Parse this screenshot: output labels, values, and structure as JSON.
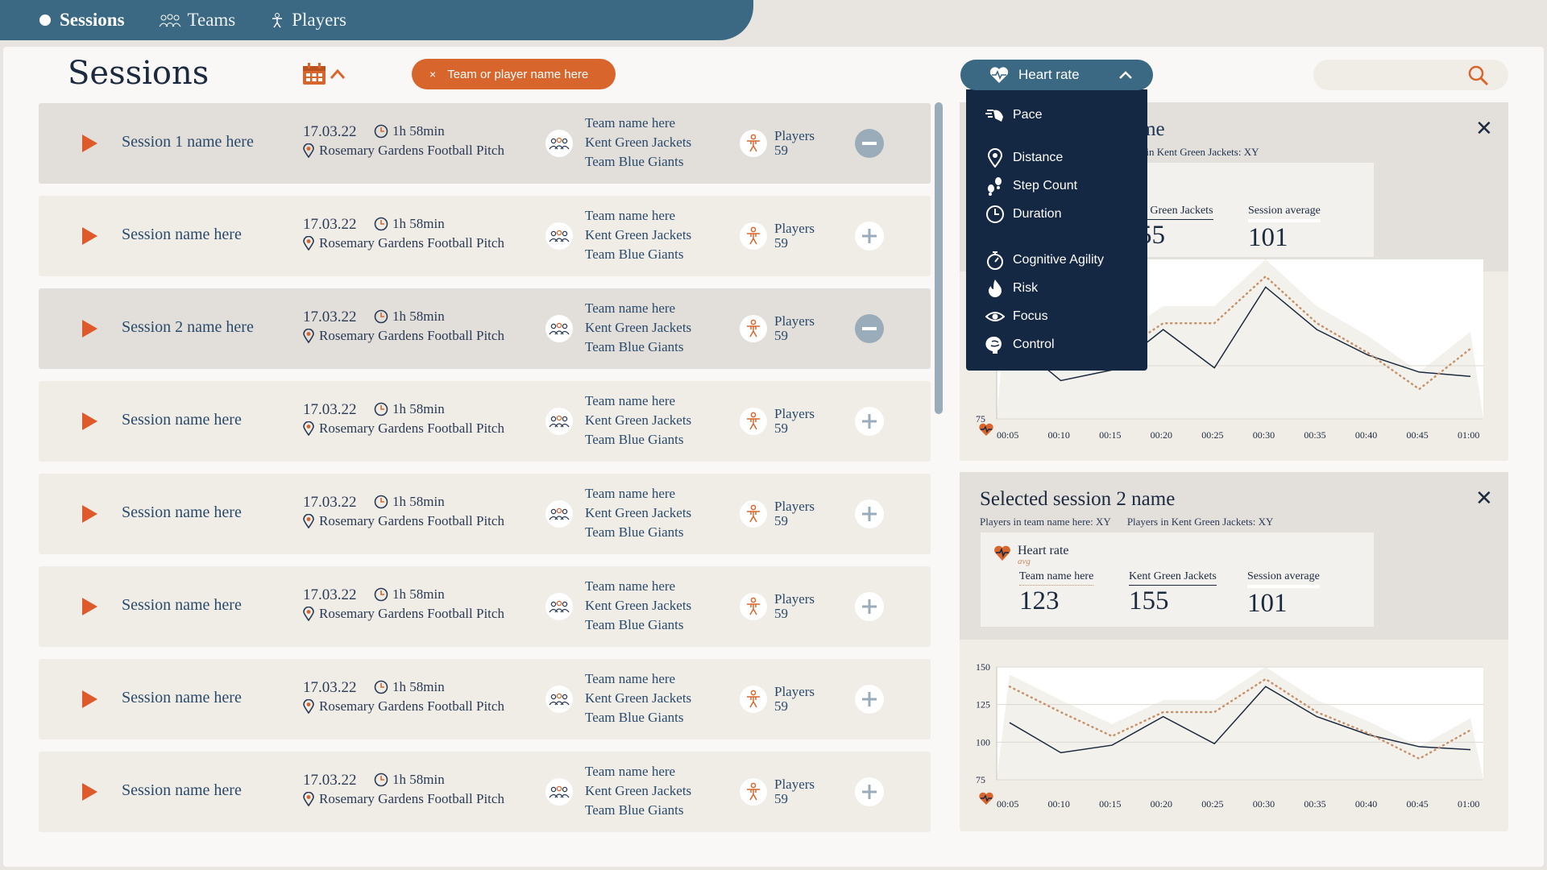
{
  "nav": {
    "items": [
      {
        "label": "Sessions",
        "icon": "sessions-icon",
        "active": true
      },
      {
        "label": "Teams",
        "icon": "teams-icon",
        "active": false
      },
      {
        "label": "Players",
        "icon": "player-icon",
        "active": false
      }
    ]
  },
  "page": {
    "title": "Sessions",
    "filter_chip": "Team or player name here",
    "filter_chip_close": "×"
  },
  "colors": {
    "nav_bg": "#3b6882",
    "accent_orange": "#d8662c",
    "play_red": "#df5a2b",
    "dropdown_bg": "#142743",
    "selected_row": "#e2deda"
  },
  "sessions": [
    {
      "name": "Session 1 name here",
      "date": "17.03.22",
      "duration": "1h 58min",
      "location": "Rosemary Gardens Football Pitch",
      "teams": [
        "Team name here",
        "Kent Green Jackets",
        "Team Blue Giants"
      ],
      "players_label": "Players",
      "players_count": "59",
      "selected": true
    },
    {
      "name": "Session name here",
      "date": "17.03.22",
      "duration": "1h 58min",
      "location": "Rosemary Gardens Football Pitch",
      "teams": [
        "Team name here",
        "Kent Green Jackets",
        "Team Blue Giants"
      ],
      "players_label": "Players",
      "players_count": "59",
      "selected": false
    },
    {
      "name": "Session 2 name here",
      "date": "17.03.22",
      "duration": "1h 58min",
      "location": "Rosemary Gardens Football Pitch",
      "teams": [
        "Team name here",
        "Kent Green Jackets",
        "Team Blue Giants"
      ],
      "players_label": "Players",
      "players_count": "59",
      "selected": true
    },
    {
      "name": "Session name here",
      "date": "17.03.22",
      "duration": "1h 58min",
      "location": "Rosemary Gardens Football Pitch",
      "teams": [
        "Team name here",
        "Kent Green Jackets",
        "Team Blue Giants"
      ],
      "players_label": "Players",
      "players_count": "59",
      "selected": false
    },
    {
      "name": "Session name here",
      "date": "17.03.22",
      "duration": "1h 58min",
      "location": "Rosemary Gardens Football Pitch",
      "teams": [
        "Team name here",
        "Kent Green Jackets",
        "Team Blue Giants"
      ],
      "players_label": "Players",
      "players_count": "59",
      "selected": false
    },
    {
      "name": "Session name here",
      "date": "17.03.22",
      "duration": "1h 58min",
      "location": "Rosemary Gardens Football Pitch",
      "teams": [
        "Team name here",
        "Kent Green Jackets",
        "Team Blue Giants"
      ],
      "players_label": "Players",
      "players_count": "59",
      "selected": false
    },
    {
      "name": "Session name here",
      "date": "17.03.22",
      "duration": "1h 58min",
      "location": "Rosemary Gardens Football Pitch",
      "teams": [
        "Team name here",
        "Kent Green Jackets",
        "Team Blue Giants"
      ],
      "players_label": "Players",
      "players_count": "59",
      "selected": false
    },
    {
      "name": "Session name here",
      "date": "17.03.22",
      "duration": "1h 58min",
      "location": "Rosemary Gardens Football Pitch",
      "teams": [
        "Team name here",
        "Kent Green Jackets",
        "Team Blue Giants"
      ],
      "players_label": "Players",
      "players_count": "59",
      "selected": false
    }
  ],
  "metric_dropdown": {
    "selected": "Heart rate",
    "options": [
      {
        "label": "Pace",
        "icon": "pace-icon"
      },
      {
        "label": "Distance",
        "icon": "location-pin-icon"
      },
      {
        "label": "Step Count",
        "icon": "footprints-icon"
      },
      {
        "label": "Duration",
        "icon": "clock-icon"
      },
      {
        "label": "Cognitive Agility",
        "icon": "stopwatch-icon"
      },
      {
        "label": "Risk",
        "icon": "flame-icon"
      },
      {
        "label": "Focus",
        "icon": "eye-icon"
      },
      {
        "label": "Control",
        "icon": "brain-icon"
      }
    ]
  },
  "search": {
    "placeholder": ""
  },
  "panel1": {
    "title_visible": "ame",
    "subtitle_visible": "ers in Kent Green Jackets: XY",
    "stats": [
      {
        "label": "nt Green Jackets",
        "value": "55"
      },
      {
        "label": "Session average",
        "value": "101"
      }
    ]
  },
  "panel2": {
    "title": "Selected session 2 name",
    "subtitle_a": "Players in team name here: XY",
    "subtitle_b": "Players in Kent Green Jackets: XY",
    "metric": "Heart rate",
    "metric_sub": "avg",
    "stats": [
      {
        "label": "Team name here",
        "value": "123"
      },
      {
        "label": "Kent Green Jackets",
        "value": "155"
      },
      {
        "label": "Session average",
        "value": "101"
      }
    ]
  },
  "chart_data": [
    {
      "type": "line",
      "x": [
        "00:05",
        "00:10",
        "00:15",
        "00:20",
        "00:25",
        "00:30",
        "00:35",
        "00:40",
        "00:45",
        "01:00"
      ],
      "ylim": [
        75,
        150
      ],
      "yticks_visible": [
        75,
        100
      ],
      "series": [
        {
          "values": [
            113,
            93,
            98,
            117,
            99,
            137,
            117,
            105,
            97,
            95
          ]
        },
        {
          "values": [
            137,
            120,
            104,
            120,
            120,
            142,
            120,
            106,
            89,
            108
          ]
        }
      ]
    },
    {
      "type": "line",
      "x": [
        "00:05",
        "00:10",
        "00:15",
        "00:20",
        "00:25",
        "00:30",
        "00:35",
        "00:40",
        "00:45",
        "01:00"
      ],
      "ylim": [
        75,
        150
      ],
      "yticks": [
        75,
        100,
        125,
        150
      ],
      "series": [
        {
          "values": [
            113,
            93,
            98,
            117,
            99,
            137,
            117,
            105,
            97,
            95
          ]
        },
        {
          "values": [
            137,
            120,
            104,
            120,
            120,
            142,
            120,
            106,
            89,
            108
          ]
        }
      ]
    }
  ]
}
